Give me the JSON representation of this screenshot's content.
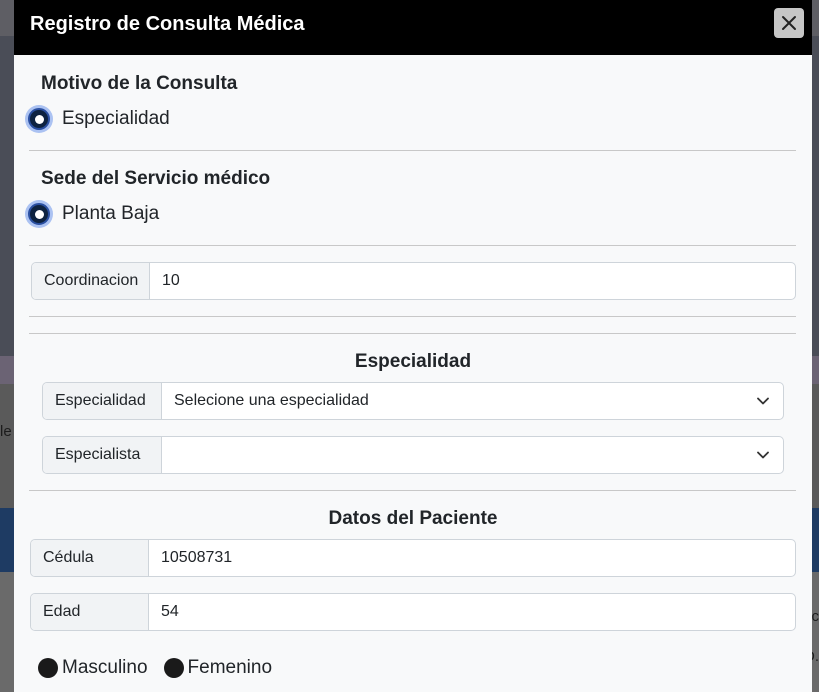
{
  "modal": {
    "title": "Registro de Consulta Médica",
    "close_icon": "close-icon"
  },
  "motivo": {
    "heading": "Motivo de la Consulta",
    "option": "Especialidad"
  },
  "sede": {
    "heading": "Sede del Servicio médico",
    "option": "Planta Baja"
  },
  "coordinacion": {
    "label": "Coordinacion",
    "value": "10"
  },
  "especialidad_section": {
    "heading": "Especialidad",
    "especialidad_label": "Especialidad",
    "especialidad_value": "Selecione una especialidad",
    "especialista_label": "Especialista",
    "especialista_value": ""
  },
  "paciente": {
    "heading": "Datos del Paciente",
    "cedula_label": "Cédula",
    "cedula_value": "10508731",
    "edad_label": "Edad",
    "edad_value": "54",
    "gender_male": "Masculino",
    "gender_female": "Femenino"
  },
  "background": {
    "left_fragment": "le",
    "right_fragment_1": "ac",
    "right_fragment_2": "D."
  },
  "colors": {
    "header_bg": "#000000",
    "modal_bg": "#f8f9fa",
    "radio_fill": "#0d2240"
  }
}
